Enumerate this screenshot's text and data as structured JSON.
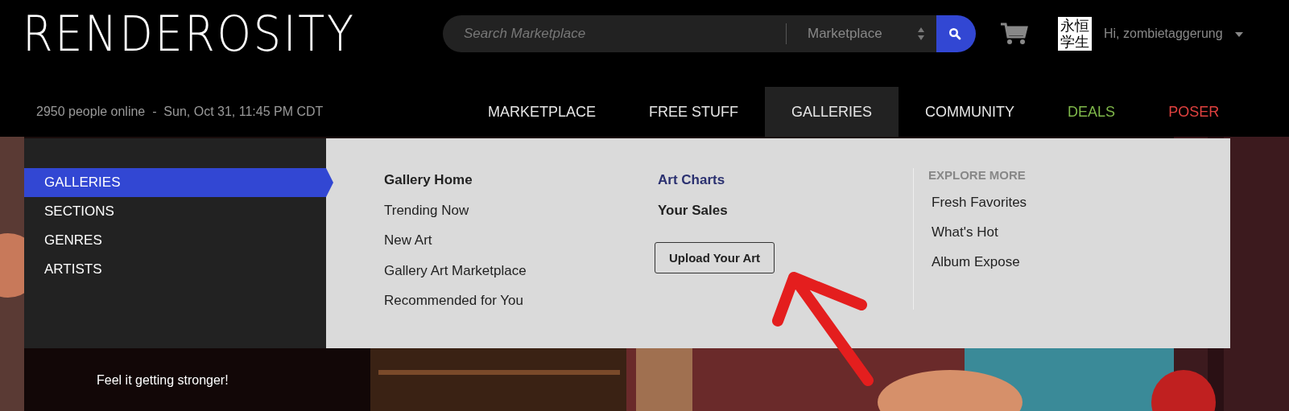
{
  "logo": "RENDEROSITY",
  "search": {
    "placeholder": "Search Marketplace",
    "scope": "Marketplace"
  },
  "user": {
    "avatar_text": "永恒学生",
    "greeting": "Hi, zombietaggerung"
  },
  "status": "2950 people online  -  Sun, Oct 31, 11:45 PM CDT",
  "nav": [
    {
      "label": "MARKETPLACE",
      "selected": false,
      "kind": "plain"
    },
    {
      "label": "FREE STUFF",
      "selected": false,
      "kind": "plain"
    },
    {
      "label": "GALLERIES",
      "selected": true,
      "kind": "plain"
    },
    {
      "label": "COMMUNITY",
      "selected": false,
      "kind": "plain"
    },
    {
      "label": "DEALS",
      "selected": false,
      "kind": "deals"
    },
    {
      "label": "POSER",
      "selected": false,
      "kind": "brand"
    }
  ],
  "menu": {
    "categories": [
      {
        "label": "GALLERIES",
        "selected": true
      },
      {
        "label": "SECTIONS",
        "selected": false
      },
      {
        "label": "GENRES",
        "selected": false
      },
      {
        "label": "ARTISTS",
        "selected": false
      }
    ],
    "columns": [
      [
        {
          "kind": "heading",
          "label": "Gallery Home"
        },
        {
          "kind": "link",
          "label": "Trending Now"
        },
        {
          "kind": "link",
          "label": "New Art"
        },
        {
          "kind": "link",
          "label": "Gallery Art Marketplace"
        },
        {
          "kind": "link",
          "label": "Recommended for You"
        }
      ],
      [
        {
          "kind": "accent",
          "label": "Art Charts"
        },
        {
          "kind": "heading",
          "label": "Your Sales"
        },
        {
          "kind": "button",
          "label": "Upload Your Art"
        }
      ]
    ],
    "explore": {
      "title": "EXPLORE MORE",
      "links": [
        "Fresh Favorites",
        "What's Hot",
        "Album Expose"
      ]
    }
  },
  "banner": {
    "caption": "Feel it getting stronger!"
  }
}
